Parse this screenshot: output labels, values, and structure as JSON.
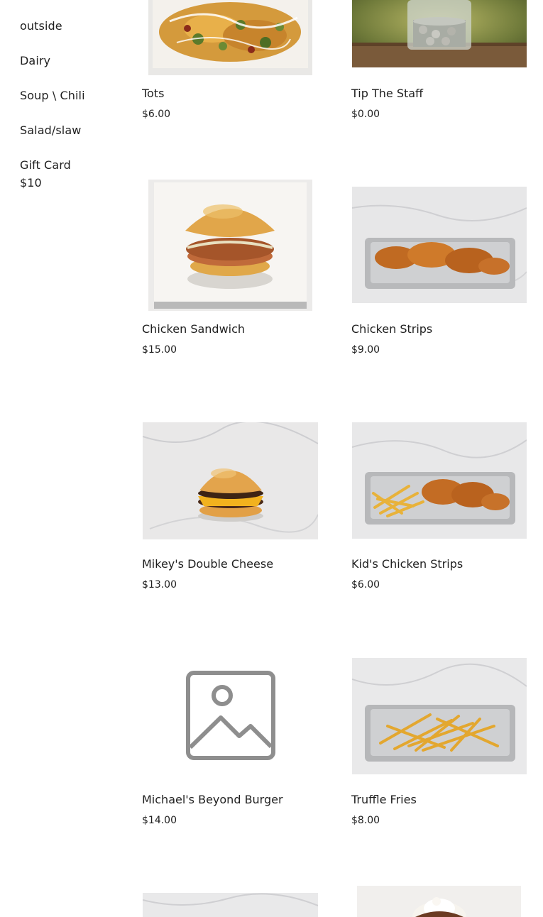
{
  "sidebar": {
    "categories": [
      "outside",
      "Dairy",
      "Soup \\ Chili",
      "Salad/slaw",
      "Gift Card",
      "$10"
    ]
  },
  "menu": {
    "items": [
      {
        "name": "Tots",
        "price": "$6.00",
        "image": "tots-photo"
      },
      {
        "name": "Tip The Staff",
        "price": "$0.00",
        "image": "tip-jar-photo"
      },
      {
        "name": "Chicken Sandwich",
        "price": "$15.00",
        "image": "chicken-sandwich-photo"
      },
      {
        "name": "Chicken Strips",
        "price": "$9.00",
        "image": "chicken-strips-photo"
      },
      {
        "name": "Mikey's Double Cheese",
        "price": "$13.00",
        "image": "cheeseburger-photo"
      },
      {
        "name": "Kid's Chicken Strips",
        "price": "$6.00",
        "image": "kids-chicken-strips-photo"
      },
      {
        "name": "Michael's Beyond Burger",
        "price": "$14.00",
        "image": "image-placeholder-icon"
      },
      {
        "name": "Truffle Fries",
        "price": "$8.00",
        "image": "truffle-fries-photo"
      },
      {
        "name": "",
        "price": "",
        "image": "marble-tray-photo"
      },
      {
        "name": "",
        "price": "",
        "image": "whipped-cream-dessert-photo"
      }
    ]
  },
  "colors": {
    "text": "#1f1f1f",
    "background": "#ffffff",
    "placeholder": "#8e8e8e"
  }
}
